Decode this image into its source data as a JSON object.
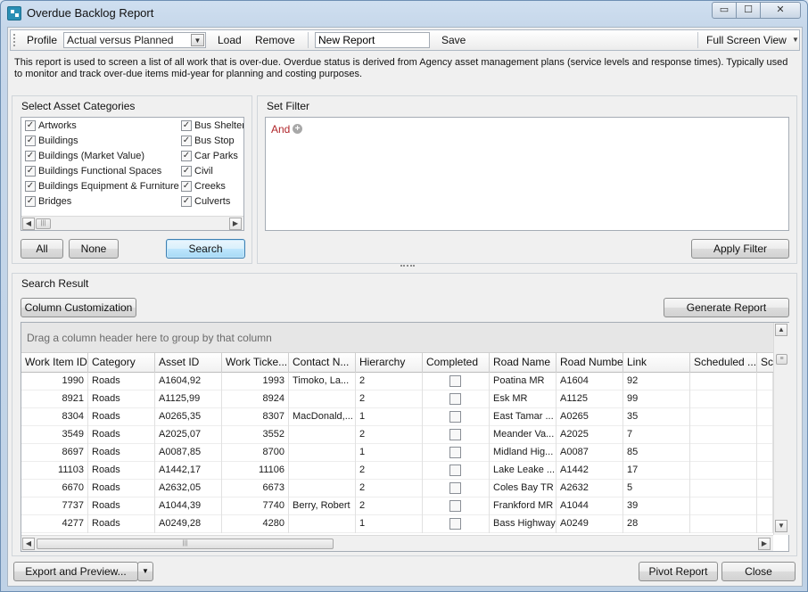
{
  "window": {
    "title": "Overdue Backlog Report",
    "controls": {
      "minimize": "▭",
      "maximize": "☐",
      "close": "✕"
    }
  },
  "toolbar": {
    "profile_label": "Profile",
    "profile_value": "Actual versus Planned",
    "load_label": "Load",
    "remove_label": "Remove",
    "report_name_value": "New Report",
    "save_label": "Save",
    "full_screen_label": "Full Screen View"
  },
  "description": "This report is used to screen a list of all work that is over-due. Overdue status is derived from Agency asset management plans (service levels and response times). Typically used to monitor and track over-due items mid-year for planning and costing purposes.",
  "asset_categories": {
    "title": "Select Asset Categories",
    "col1": [
      {
        "label": "Artworks",
        "checked": true
      },
      {
        "label": "Buildings",
        "checked": true
      },
      {
        "label": "Buildings (Market Value)",
        "checked": true
      },
      {
        "label": "Buildings Functional Spaces",
        "checked": true
      },
      {
        "label": "Buildings Equipment & Furniture",
        "checked": true
      },
      {
        "label": "Bridges",
        "checked": true
      }
    ],
    "col2": [
      {
        "label": "Bus Shelters",
        "checked": true
      },
      {
        "label": "Bus Stop",
        "checked": true
      },
      {
        "label": "Car Parks",
        "checked": true
      },
      {
        "label": "Civil",
        "checked": true
      },
      {
        "label": "Creeks",
        "checked": true
      },
      {
        "label": "Culverts",
        "checked": true
      }
    ],
    "all_label": "All",
    "none_label": "None",
    "search_label": "Search"
  },
  "filter": {
    "title": "Set Filter",
    "operator": "And",
    "apply_label": "Apply Filter"
  },
  "search_result": {
    "title": "Search Result",
    "column_customization_label": "Column Customization",
    "generate_report_label": "Generate Report",
    "group_hint": "Drag a column header here to group by that column",
    "columns": [
      "Work Item ID",
      "Category",
      "Asset ID",
      "Work Ticke...",
      "Contact N...",
      "Hierarchy",
      "Completed",
      "Road Name",
      "Road Number",
      "Link",
      "Scheduled ...",
      "Sc"
    ],
    "rows": [
      {
        "work_item_id": "1990",
        "category": "Roads",
        "asset_id": "A1604,92",
        "work_ticket": "1993",
        "contact": "Timoko, La...",
        "hierarchy": "2",
        "road_name": "Poatina MR",
        "road_number": "A1604",
        "link": "92"
      },
      {
        "work_item_id": "8921",
        "category": "Roads",
        "asset_id": "A1125,99",
        "work_ticket": "8924",
        "contact": "",
        "hierarchy": "2",
        "road_name": "Esk MR",
        "road_number": "A1125",
        "link": "99"
      },
      {
        "work_item_id": "8304",
        "category": "Roads",
        "asset_id": "A0265,35",
        "work_ticket": "8307",
        "contact": "MacDonald,...",
        "hierarchy": "1",
        "road_name": "East Tamar ...",
        "road_number": "A0265",
        "link": "35"
      },
      {
        "work_item_id": "3549",
        "category": "Roads",
        "asset_id": "A2025,07",
        "work_ticket": "3552",
        "contact": "",
        "hierarchy": "2",
        "road_name": "Meander Va...",
        "road_number": "A2025",
        "link": "7"
      },
      {
        "work_item_id": "8697",
        "category": "Roads",
        "asset_id": "A0087,85",
        "work_ticket": "8700",
        "contact": "",
        "hierarchy": "1",
        "road_name": "Midland Hig...",
        "road_number": "A0087",
        "link": "85"
      },
      {
        "work_item_id": "11103",
        "category": "Roads",
        "asset_id": "A1442,17",
        "work_ticket": "11106",
        "contact": "",
        "hierarchy": "2",
        "road_name": "Lake Leake ...",
        "road_number": "A1442",
        "link": "17"
      },
      {
        "work_item_id": "6670",
        "category": "Roads",
        "asset_id": "A2632,05",
        "work_ticket": "6673",
        "contact": "",
        "hierarchy": "2",
        "road_name": "Coles Bay TR",
        "road_number": "A2632",
        "link": "5"
      },
      {
        "work_item_id": "7737",
        "category": "Roads",
        "asset_id": "A1044,39",
        "work_ticket": "7740",
        "contact": "Berry, Robert",
        "hierarchy": "2",
        "road_name": "Frankford MR",
        "road_number": "A1044",
        "link": "39"
      },
      {
        "work_item_id": "4277",
        "category": "Roads",
        "asset_id": "A0249,28",
        "work_ticket": "4280",
        "contact": "",
        "hierarchy": "1",
        "road_name": "Bass Highway",
        "road_number": "A0249",
        "link": "28"
      }
    ]
  },
  "footer": {
    "export_label": "Export and Preview...",
    "pivot_label": "Pivot Report",
    "close_label": "Close"
  }
}
